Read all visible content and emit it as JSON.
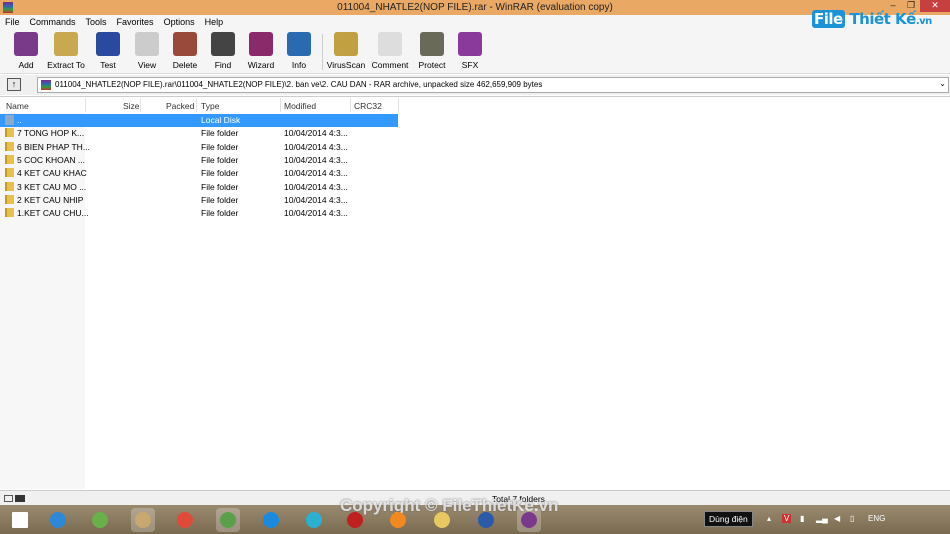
{
  "window": {
    "title": "011004_NHATLE2(NOP FILE).rar - WinRAR (evaluation copy)",
    "minimize": "–",
    "maximize": "❐",
    "close": "✕"
  },
  "watermark": {
    "logo_file": "File",
    "logo_rest": "Thiết Kế",
    "logo_tld": ".vn",
    "copyright": "Copyright © FileThietKe.vn"
  },
  "menu": [
    "File",
    "Commands",
    "Tools",
    "Favorites",
    "Options",
    "Help"
  ],
  "toolbar": [
    {
      "label": "Add",
      "icon": "add-archive-icon",
      "color": "#7a3a8a"
    },
    {
      "label": "Extract To",
      "icon": "extract-icon",
      "color": "#c8a850"
    },
    {
      "label": "Test",
      "icon": "test-icon",
      "color": "#2a4aa0"
    },
    {
      "label": "View",
      "icon": "view-icon",
      "color": "#ccc"
    },
    {
      "label": "Delete",
      "icon": "delete-icon",
      "color": "#9a4a3a"
    },
    {
      "label": "Find",
      "icon": "find-binoculars-icon",
      "color": "#444"
    },
    {
      "label": "Wizard",
      "icon": "wizard-icon",
      "color": "#8a2a6a"
    },
    {
      "label": "Info",
      "icon": "info-icon",
      "color": "#2a6ab0"
    },
    {
      "label": "VirusScan",
      "icon": "virusscan-icon",
      "color": "#c0a040"
    },
    {
      "label": "Comment",
      "icon": "comment-icon",
      "color": "#ddd"
    },
    {
      "label": "Protect",
      "icon": "protect-shield-icon",
      "color": "#6a6a5a"
    },
    {
      "label": "SFX",
      "icon": "sfx-icon",
      "color": "#8a3a9a"
    }
  ],
  "address": {
    "path": "011004_NHATLE2(NOP FILE).rar\\011004_NHATLE2(NOP FILE)\\2. ban ve\\2. CAU DAN - RAR archive, unpacked size 462,659,909 bytes",
    "up_icon": "up-folder-icon"
  },
  "columns": [
    "Name",
    "Size",
    "Packed",
    "Type",
    "Modified",
    "CRC32"
  ],
  "rows": [
    {
      "name": "..",
      "size": "",
      "packed": "",
      "type": "Local Disk",
      "modified": "",
      "crc": "",
      "selected": true
    },
    {
      "name": "7 TONG HOP K...",
      "size": "",
      "packed": "",
      "type": "File folder",
      "modified": "10/04/2014 4:3...",
      "crc": ""
    },
    {
      "name": "6 BIEN PHAP TH...",
      "size": "",
      "packed": "",
      "type": "File folder",
      "modified": "10/04/2014 4:3...",
      "crc": ""
    },
    {
      "name": "5 COC KHOAN ...",
      "size": "",
      "packed": "",
      "type": "File folder",
      "modified": "10/04/2014 4:3...",
      "crc": ""
    },
    {
      "name": "4 KET CAU KHAC",
      "size": "",
      "packed": "",
      "type": "File folder",
      "modified": "10/04/2014 4:3...",
      "crc": ""
    },
    {
      "name": "3 KET CAU MO ...",
      "size": "",
      "packed": "",
      "type": "File folder",
      "modified": "10/04/2014 4:3...",
      "crc": ""
    },
    {
      "name": "2 KET CAU NHIP",
      "size": "",
      "packed": "",
      "type": "File folder",
      "modified": "10/04/2014 4:3...",
      "crc": ""
    },
    {
      "name": "1.KET CAU CHU...",
      "size": "",
      "packed": "",
      "type": "File folder",
      "modified": "10/04/2014 4:3...",
      "crc": ""
    }
  ],
  "status": {
    "text": "Total 7 folders"
  },
  "taskbar": {
    "apps": [
      {
        "name": "start",
        "color": "#fff"
      },
      {
        "name": "internet-explorer",
        "color": "#2a8ad8"
      },
      {
        "name": "utorrent",
        "color": "#6ab04a"
      },
      {
        "name": "paint",
        "color": "#c8a870",
        "active": true
      },
      {
        "name": "chrome",
        "color": "#e04a3a"
      },
      {
        "name": "coccoc",
        "color": "#5aa04a",
        "active": true
      },
      {
        "name": "zalo",
        "color": "#1a8ae0"
      },
      {
        "name": "picpick",
        "color": "#2ab0d0"
      },
      {
        "name": "autocad",
        "color": "#c02020"
      },
      {
        "name": "foxit-pdf",
        "color": "#f08a20"
      },
      {
        "name": "file-explorer",
        "color": "#e8c860"
      },
      {
        "name": "word",
        "color": "#2a5aa8"
      },
      {
        "name": "winrar",
        "color": "#7a3a8a",
        "active": true
      }
    ],
    "tooltip": "Dùng điện",
    "language": "ENG"
  }
}
